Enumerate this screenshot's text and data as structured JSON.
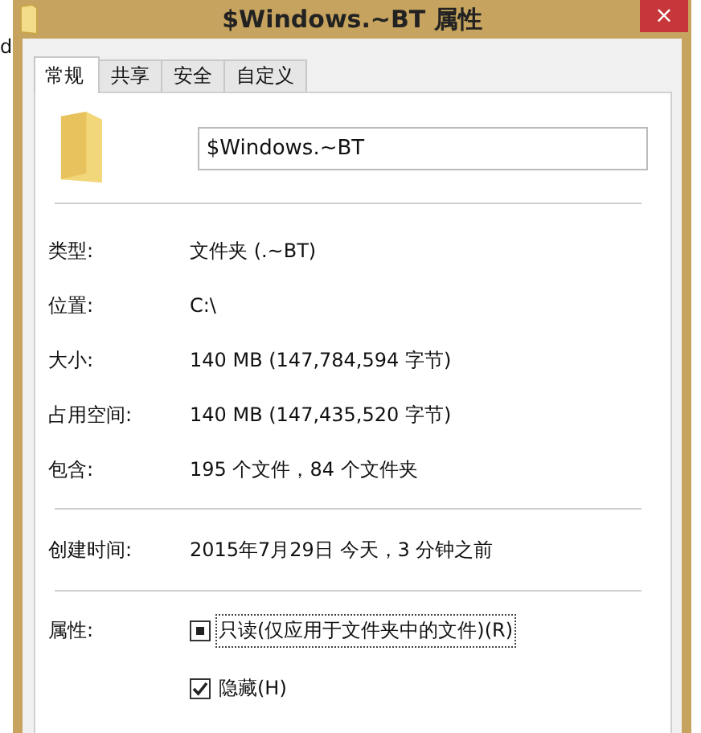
{
  "background_text": "d",
  "window": {
    "title": "$Windows.~BT 属性",
    "close": "×"
  },
  "tabs": [
    {
      "label": "常规",
      "selected": true
    },
    {
      "label": "共享",
      "selected": false
    },
    {
      "label": "安全",
      "selected": false
    },
    {
      "label": "自定义",
      "selected": false
    }
  ],
  "name_field": {
    "value": "$Windows.~BT"
  },
  "properties": [
    {
      "label": "类型:",
      "value": "文件夹 (.~BT)"
    },
    {
      "label": "位置:",
      "value": "C:\\"
    },
    {
      "label": "大小:",
      "value": "140 MB (147,784,594 字节)"
    },
    {
      "label": "占用空间:",
      "value": "140 MB (147,435,520 字节)"
    },
    {
      "label": "包含:",
      "value": "195 个文件，84 个文件夹"
    }
  ],
  "created": {
    "label": "创建时间:",
    "value": "2015年7月29日 今天，3 分钟之前"
  },
  "attributes": {
    "label": "属性:",
    "options": [
      {
        "label": "只读(仅应用于文件夹中的文件)(R)",
        "kind": "tristate",
        "checked": true,
        "focused": true
      },
      {
        "label": "隐藏(H)",
        "kind": "checkbox",
        "checked": true,
        "focused": false
      }
    ]
  }
}
